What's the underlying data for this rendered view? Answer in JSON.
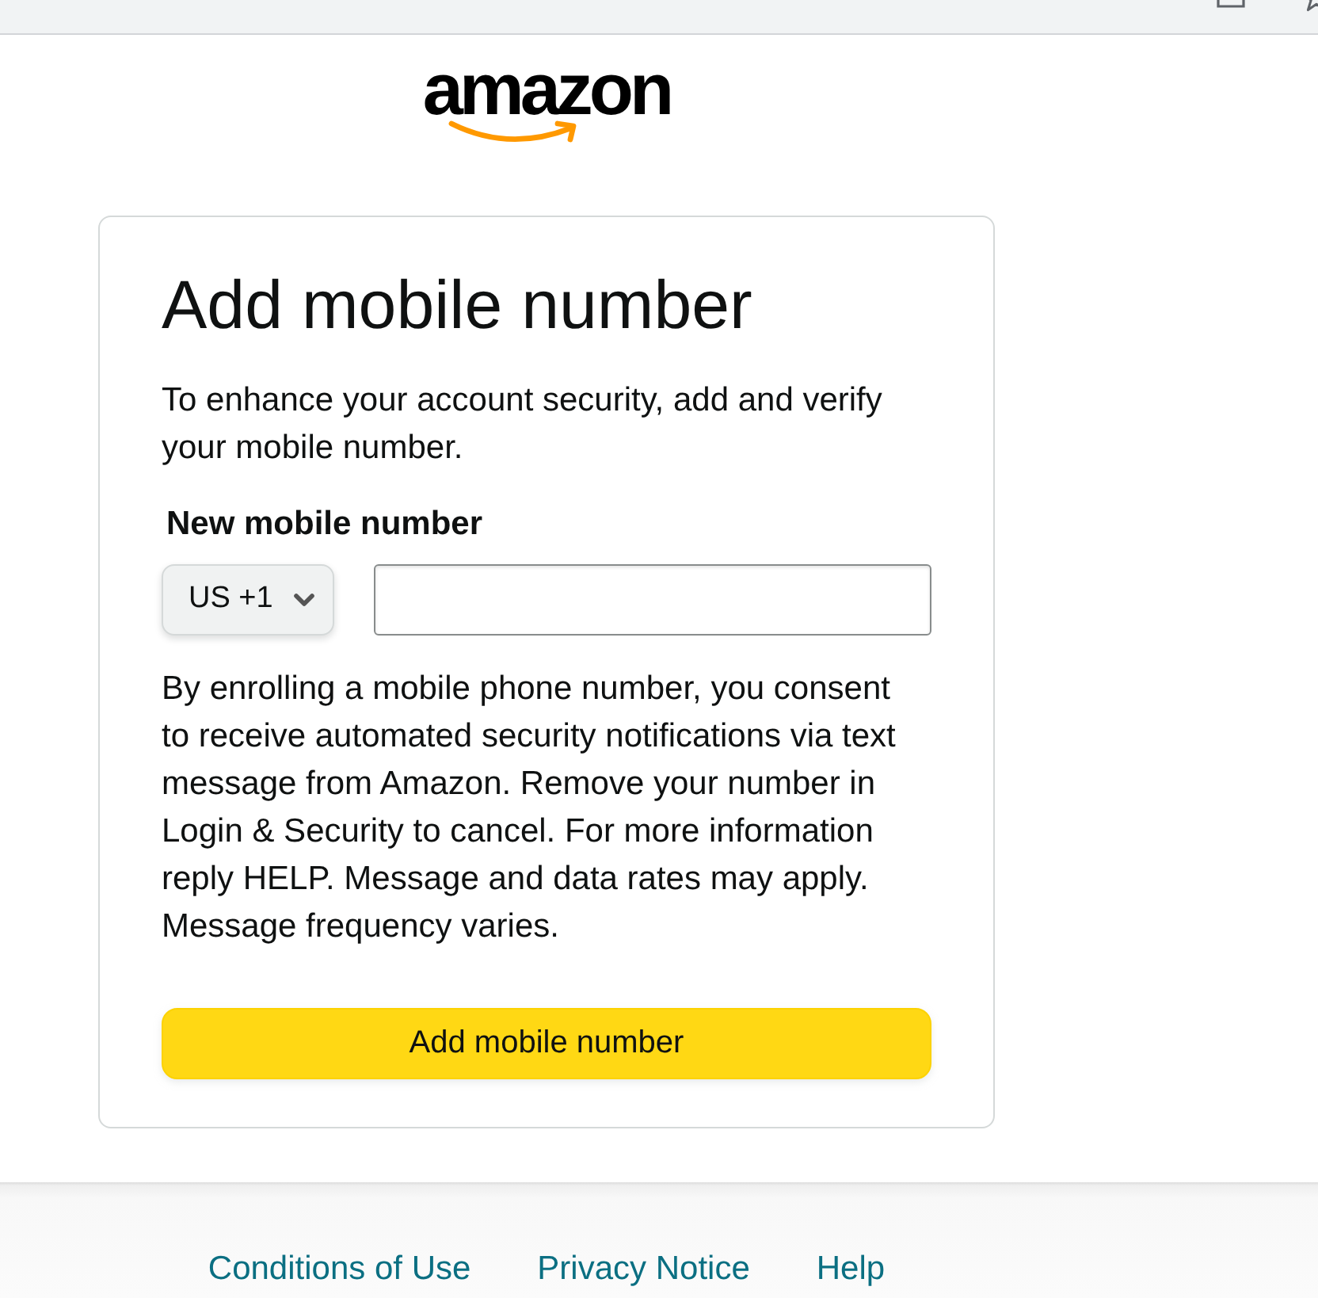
{
  "logo": {
    "text": "amazon"
  },
  "card": {
    "title": "Add mobile number",
    "description": "To enhance your account security, add and verify your mobile number.",
    "phone_label": "New mobile number",
    "country_code": "US +1",
    "consent": "By enrolling a mobile phone number, you consent to receive automated security notifications via text message from Amazon. Remove your number in Login & Security to cancel. For more information reply HELP. Message and data rates may apply. Message frequency varies.",
    "submit_button": "Add mobile number"
  },
  "footer": {
    "links": [
      "Conditions of Use",
      "Privacy Notice",
      "Help"
    ]
  }
}
